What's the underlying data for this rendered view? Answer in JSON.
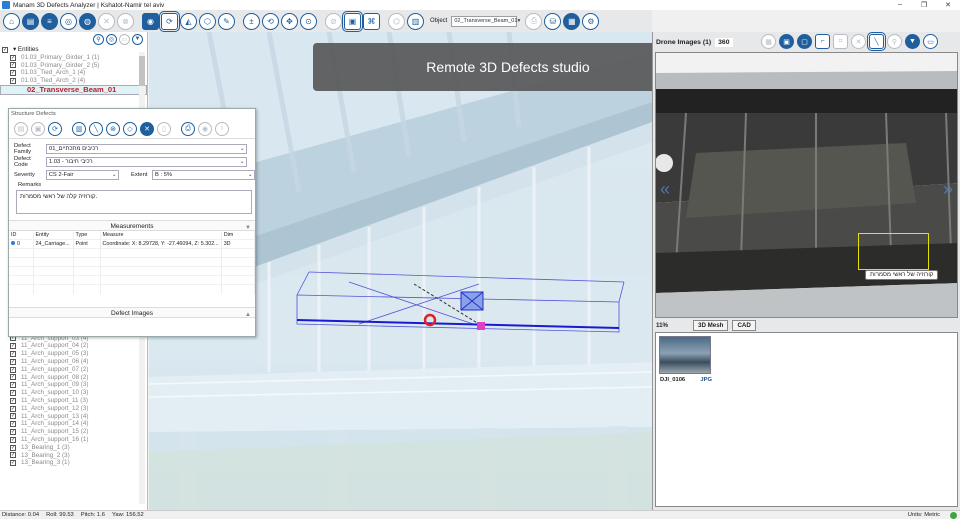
{
  "window": {
    "title": "Manam 3D Defects Analyzer",
    "project": "Kshatot-Namir tel aviv"
  },
  "toolbar": {
    "object_label": "Object",
    "object_value": "02_Transverse_Beam_01",
    "icons": [
      "home-icon",
      "folder-icon",
      "menu-icon",
      "layers-icon",
      "measure-icon",
      "close-grey-icon",
      "structure-icon",
      "stop-grey-icon",
      "view-cube-icon",
      "camera-icon",
      "cube-icon",
      "paint-icon",
      "rotate-icon",
      "plus-minus-icon",
      "pan-icon",
      "zoom-icon",
      "section-icon",
      "shape-icon",
      "pin-grey-icon",
      "defects-icon",
      "annotate-icon",
      "print-icon",
      "db-icon",
      "settings-gear-icon"
    ]
  },
  "tree": {
    "root_label": "Entities",
    "items_top": [
      "01.03_Primary_Girder_1 (1)",
      "01.03_Primary_Girder_2 (5)",
      "01.03_Tied_Arch_1 (4)",
      "01.03_Tied_Arch_2 (4)"
    ],
    "selected": "02_Transverse_Beam_01",
    "items_bottom": [
      "11_Arch_support_01 (2)",
      "11_Arch_support_02 (3)",
      "11_Arch_support_03 (4)",
      "11_Arch_support_04 (2)",
      "11_Arch_support_05 (3)",
      "11_Arch_support_06 (4)",
      "11_Arch_support_07 (2)",
      "11_Arch_support_08 (2)",
      "11_Arch_support_09 (3)",
      "11_Arch_support_10 (3)",
      "11_Arch_support_11 (3)",
      "11_Arch_support_12 (3)",
      "11_Arch_support_13 (4)",
      "11_Arch_support_14 (4)",
      "11_Arch_support_15 (2)",
      "11_Arch_support_16 (1)",
      "13_Bearing_1 (3)",
      "13_Bearing_2 (3)",
      "13_Bearing_3 (1)"
    ]
  },
  "banner": {
    "text": "Remote 3D Defects studio"
  },
  "dialog": {
    "title": "Structure Defects",
    "defect_family_label": "Defect Family",
    "defect_family_value": "01_רכיבים מתכתיים",
    "defect_code_label": "Defect Code",
    "defect_code_value": "1.03 - רכיבי חיבור",
    "severity_label": "Severity",
    "severity_value": "CS 2-Fair",
    "extent_label": "Extent",
    "extent_value": "B : 5%",
    "remarks_label": "Remarks",
    "remarks_value": "קורוזיה קלה של ראשי מסמרות.",
    "measurements_title": "Measurements",
    "columns": {
      "id": "ID",
      "entity": "Entity",
      "type": "Type",
      "measure": "Measure",
      "dim": "Dim"
    },
    "rows": [
      {
        "id": "0",
        "entity": "24_Carriage...",
        "type": "Point",
        "measure": "Coordinate: X: 8.29728, Y: -27.46094, Z: 5.302...",
        "dim": "3D"
      }
    ],
    "defect_images_title": "Defect Images"
  },
  "drone": {
    "title": "Drone Images (1)",
    "count": "360",
    "tooltip": "קורוזיה של ראשי מסמרות",
    "progress": "11%",
    "btn_mesh": "3D Mesh",
    "btn_cad": "CAD",
    "thumb_name": "DJI_0106",
    "thumb_ext": "JPG"
  },
  "status": {
    "distance": "Distance:   0.04",
    "roll": "Roll:  99.53",
    "pitch": "Pitch:   1.6",
    "yaw": "Yaw:  156.52",
    "units": "Units:  Metric"
  },
  "colors": {
    "accent": "#1f5f9e",
    "selected_tree": "#b8202d",
    "defect_box": "#e8e000",
    "status_ok": "#3fa542"
  }
}
